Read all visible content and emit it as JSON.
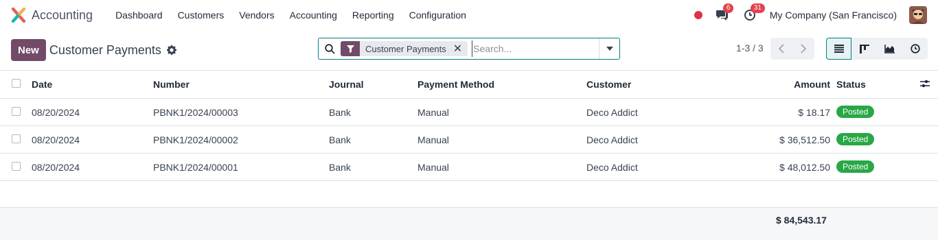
{
  "navbar": {
    "app_name": "Accounting",
    "menu": [
      "Dashboard",
      "Customers",
      "Vendors",
      "Accounting",
      "Reporting",
      "Configuration"
    ],
    "messages_badge": "6",
    "activities_badge": "31",
    "company": "My Company (San Francisco)"
  },
  "control": {
    "new_label": "New",
    "title": "Customer Payments",
    "search": {
      "facet": "Customer Payments",
      "placeholder": "Search..."
    },
    "pager": "1-3 / 3"
  },
  "table": {
    "headers": [
      "Date",
      "Number",
      "Journal",
      "Payment Method",
      "Customer",
      "Amount",
      "Status"
    ],
    "rows": [
      {
        "date": "08/20/2024",
        "number": "PBNK1/2024/00003",
        "journal": "Bank",
        "method": "Manual",
        "customer": "Deco Addict",
        "amount": "$ 18.17",
        "status": "Posted"
      },
      {
        "date": "08/20/2024",
        "number": "PBNK1/2024/00002",
        "journal": "Bank",
        "method": "Manual",
        "customer": "Deco Addict",
        "amount": "$ 36,512.50",
        "status": "Posted"
      },
      {
        "date": "08/20/2024",
        "number": "PBNK1/2024/00001",
        "journal": "Bank",
        "method": "Manual",
        "customer": "Deco Addict",
        "amount": "$ 48,012.50",
        "status": "Posted"
      }
    ],
    "total": "$ 84,543.17"
  },
  "colors": {
    "brand": "#714b67",
    "accent": "#017e84",
    "posted": "#28a745",
    "badge": "#e5414d"
  }
}
